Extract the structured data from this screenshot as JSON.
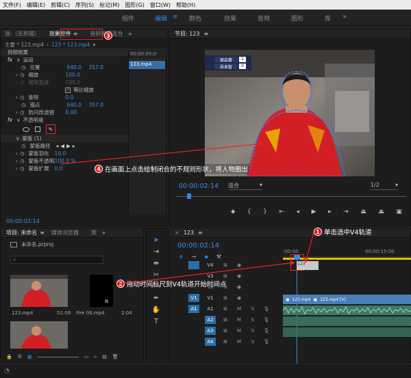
{
  "menu": [
    "文件(F)",
    "编辑(E)",
    "剪辑(C)",
    "序列(S)",
    "标记(M)",
    "图形(G)",
    "窗口(W)",
    "帮助(H)"
  ],
  "workspaces": {
    "items": [
      "组件",
      "编辑",
      "颜色",
      "效果",
      "音频",
      "图形",
      "库"
    ],
    "active": "编辑"
  },
  "effect_controls": {
    "tabs": {
      "source": "源:（无剪辑）",
      "effect_controls": "效果控件",
      "mixer": "音频剪辑混合"
    },
    "clip_main": "主要 * 123.mp4",
    "clip_seq": "123 * 123.mp4",
    "ruler_time": "00:00:05:0",
    "clip_label": "123.mp4",
    "video_effects": "视频效果",
    "motion": "运动",
    "position": {
      "label": "位置",
      "x": "640.0",
      "y": "357.0"
    },
    "scale": {
      "label": "缩放",
      "value": "100.0"
    },
    "scale_width": {
      "label": "缩放宽度",
      "value": "100.0"
    },
    "uniform_scale": "等比缩放",
    "rotation": {
      "label": "旋转",
      "value": "0.0"
    },
    "anchor": {
      "label": "锚点",
      "x": "640.0",
      "y": "357.0"
    },
    "anti_flicker": {
      "label": "防闪烁滤镜",
      "value": "0.00"
    },
    "opacity": "不透明度",
    "mask": "蒙版 (1)",
    "mask_path": "蒙版路径",
    "mask_feather": {
      "label": "蒙版羽化",
      "value": "10.0"
    },
    "mask_opacity": {
      "label": "蒙版不透明度",
      "value": "100.0 %"
    },
    "mask_expansion": {
      "label": "蒙版扩展",
      "value": "0.0"
    },
    "timecode": "00:00:02:14"
  },
  "program": {
    "title": "节目: 123",
    "timecode": "00:00:02:14",
    "fit": "适合",
    "quality": "1/2",
    "scoreboard": {
      "p1": "周启豪",
      "p2": "张本智",
      "s1": "1",
      "s2": "0"
    }
  },
  "project": {
    "tabs": {
      "project": "项目: 未命名",
      "media": "媒体浏览器",
      "lib": "库"
    },
    "filename": "未命名.prproj",
    "items": [
      {
        "name": "123.mp4",
        "duration": "51:09"
      },
      {
        "name": "Fire 06.mp4",
        "duration": "1:04"
      }
    ]
  },
  "timeline": {
    "seq_name": "123",
    "timecode": "00:00:02:14",
    "ruler": [
      ":00:00",
      "00:00:15:00"
    ],
    "clip_v1": "123.mp4",
    "clip_v1b": "123.mp4 [V]",
    "clip_v4": "123",
    "tracks": [
      "V4",
      "V3",
      "V2",
      "V1",
      "A1",
      "A2",
      "A3",
      "A4"
    ],
    "source_v": "V1",
    "source_a": "A1"
  },
  "callouts": {
    "c1": {
      "num": "1",
      "text": "单击选中V4轨道"
    },
    "c2": {
      "num": "2",
      "text": "拖动时间标尺到V4轨道开始时间点"
    },
    "c3": {
      "num": "3",
      "text": ""
    },
    "c4": {
      "num": "4",
      "text": "在画面上点击绘制闭合的不规则形状，将人物圈出"
    }
  },
  "colors": {
    "accent": "#2d8ceb",
    "callout": "#d4140c",
    "mask": "#3a7bff"
  }
}
